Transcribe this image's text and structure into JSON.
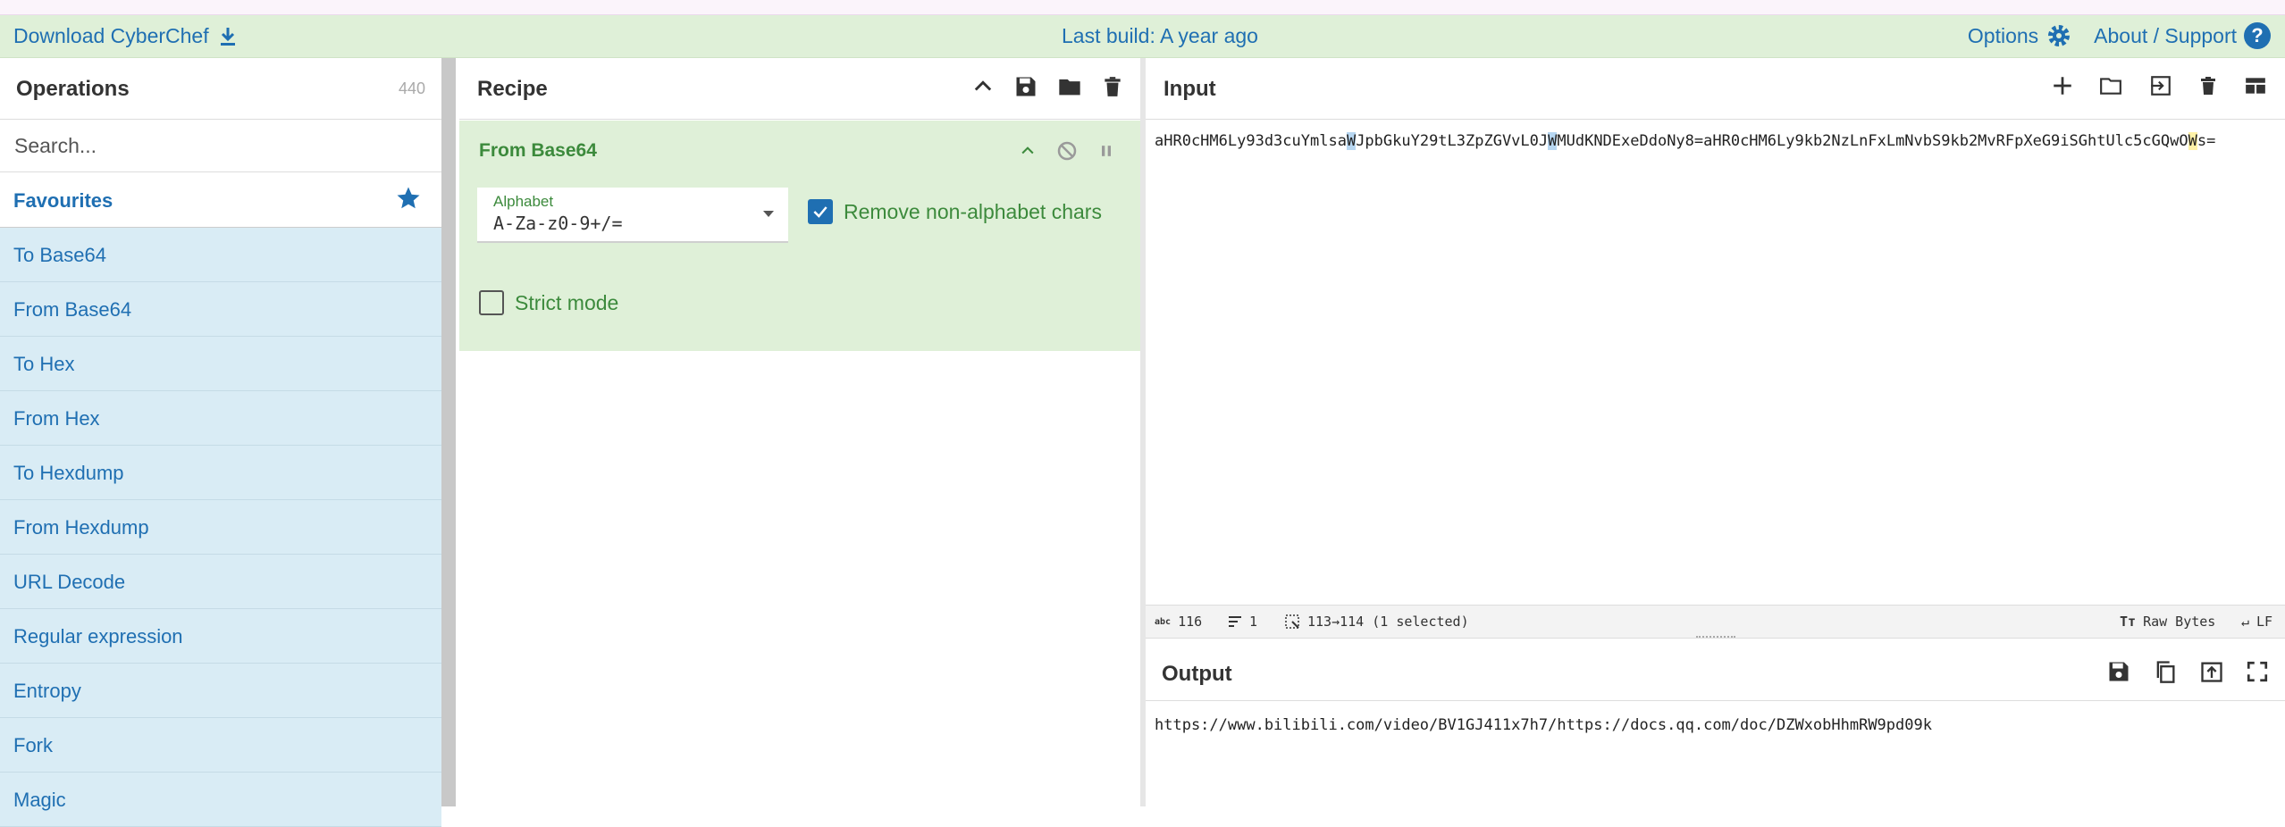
{
  "banner": {
    "download_label": "Download CyberChef",
    "last_build": "Last build: A year ago",
    "options_label": "Options",
    "about_label": "About / Support"
  },
  "operations": {
    "title": "Operations",
    "count": "440",
    "search_placeholder": "Search...",
    "favourites_label": "Favourites",
    "items": [
      "To Base64",
      "From Base64",
      "To Hex",
      "From Hex",
      "To Hexdump",
      "From Hexdump",
      "URL Decode",
      "Regular expression",
      "Entropy",
      "Fork",
      "Magic"
    ]
  },
  "recipe": {
    "title": "Recipe",
    "operation": {
      "name": "From Base64",
      "alphabet_label": "Alphabet",
      "alphabet_value": "A-Za-z0-9+/=",
      "remove_label": "Remove non-alphabet chars",
      "remove_checked": true,
      "strict_label": "Strict mode",
      "strict_checked": false
    }
  },
  "input": {
    "title": "Input",
    "text_parts": {
      "p1": "aHR0cHM6Ly93d3cuYmlsa",
      "p2": "W",
      "p3": "JpbGkuY29tL3ZpZGVvL0J",
      "p4": "W",
      "p5": "MUdKNDExeDdoNy8=aHR0cHM6Ly9kb2NzLnFxLmNvbS9kb2MvRFpXeG9iSGhtUlc5c",
      "p6": "GQwO",
      "p7": "W",
      "p8": "s="
    }
  },
  "statusbar": {
    "char_count": "116",
    "line_count": "1",
    "selection": "113→114 (1 selected)",
    "encoding": "Raw Bytes",
    "eol": "LF"
  },
  "output": {
    "title": "Output",
    "text": "https://www.bilibili.com/video/BV1GJ411x7h7/https://docs.qq.com/doc/DZWxobHhmRW9pd09k"
  },
  "colors": {
    "accent": "#1f6fb2",
    "banner_bg": "#dff0d8",
    "operation_green": "#3c8a3c",
    "op_list_bg": "#d9ecf5"
  }
}
